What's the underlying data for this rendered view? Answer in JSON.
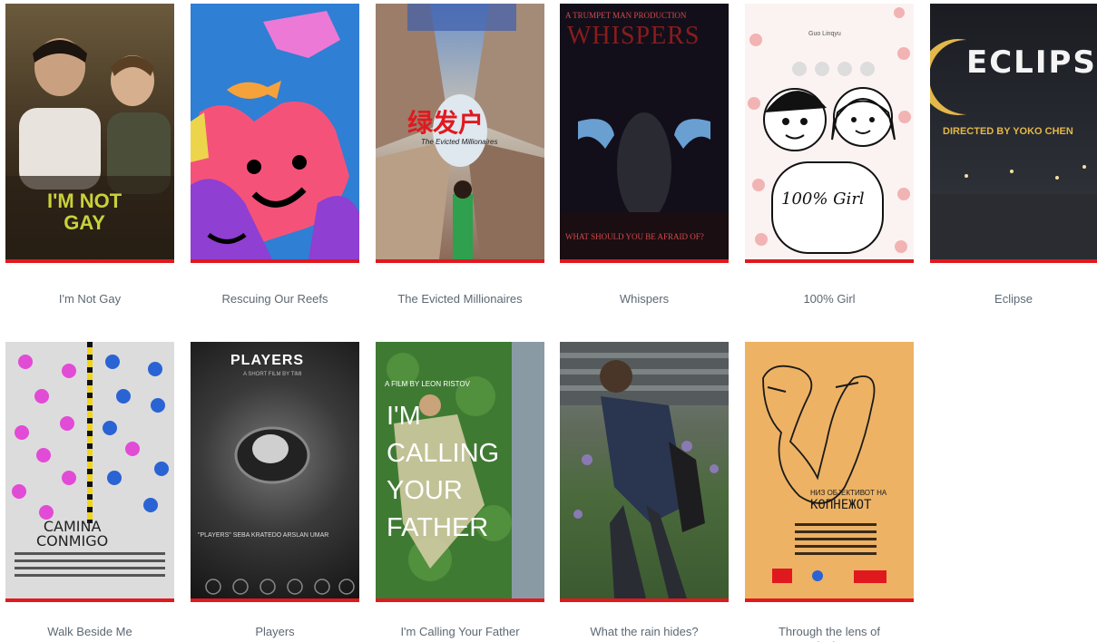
{
  "films": [
    {
      "title": "I'm Not Gay",
      "poster_text": "I'M NOT\nGAY"
    },
    {
      "title": "Rescuing Our Reefs"
    },
    {
      "title": "The Evicted Millionaires",
      "poster_text": "绿发户",
      "poster_subtitle": "The Evicted Millionaires"
    },
    {
      "title": "Whispers",
      "poster_top": "A TRUMPET MAN PRODUCTION",
      "poster_text": "WHISPERS",
      "poster_tagline": "WHAT SHOULD YOU BE AFRAID OF?"
    },
    {
      "title": "100% Girl",
      "poster_text": "100% Girl",
      "poster_top": "Guo Linqyu"
    },
    {
      "title": "Eclipse",
      "poster_text": "ECLIPSE",
      "poster_subtitle": "DIRECTED BY YOKO CHEN"
    },
    {
      "title": "Walk Beside Me",
      "poster_text": "CAMINA\nCONMIGO"
    },
    {
      "title": "Players",
      "poster_text": "PLAYERS",
      "poster_subtitle": "A SHORT FILM BY TIMI",
      "poster_tagline": "\"PLAYERS\" SEBA KRATEDO ARSLAN UMAR"
    },
    {
      "title": "I'm Calling Your Father",
      "poster_top": "A FILM BY LEON RISTOV",
      "poster_text": "I'M\nCALLING\nYOUR\nFATHER"
    },
    {
      "title": "What the rain hides?"
    },
    {
      "title": "Through the lens of desire",
      "poster_text": "КОПНЕЖОТ",
      "poster_subtitle": "НИЗ ОБЈЕКТИВОТ НА"
    }
  ],
  "colors": {
    "accent_bar": "#e0191f",
    "title_text": "#5d6872"
  }
}
